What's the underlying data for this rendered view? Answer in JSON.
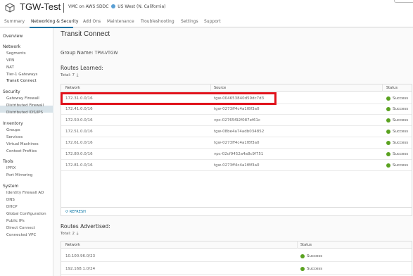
{
  "header": {
    "sddc_name": "TGW-Test",
    "subtitle": "VMC on AWS SDDC",
    "region": "US West (N. California)"
  },
  "tabs": [
    {
      "label": "Summary"
    },
    {
      "label": "Networking & Security",
      "active": true
    },
    {
      "label": "Add Ons"
    },
    {
      "label": "Maintenance"
    },
    {
      "label": "Troubleshooting"
    },
    {
      "label": "Settings"
    },
    {
      "label": "Support"
    }
  ],
  "sidebar": {
    "overview": "Overview",
    "sections": [
      {
        "title": "Network",
        "items": [
          "Segments",
          "VPN",
          "NAT",
          "Tier-1 Gateways",
          "Transit Connect"
        ]
      },
      {
        "title": "Security",
        "items": [
          "Gateway Firewall",
          "Distributed Firewall",
          "Distributed IDS/IPS"
        ]
      },
      {
        "title": "Inventory",
        "items": [
          "Groups",
          "Services",
          "Virtual Machines",
          "Context Profiles"
        ]
      },
      {
        "title": "Tools",
        "items": [
          "IPFIX",
          "Port Mirroring"
        ]
      },
      {
        "title": "System",
        "items": [
          "Identity Firewall AD",
          "DNS",
          "DHCP",
          "Global Configuration",
          "Public IPs",
          "Direct Connect",
          "Connected VPC"
        ]
      }
    ],
    "active_item": "Transit Connect"
  },
  "main": {
    "title": "Transit Connect",
    "group_name_label": "Group Name:",
    "group_name_value": "TPM-VTGW",
    "routes_learned": {
      "title": "Routes Learned:",
      "total": "Total: 7",
      "columns": [
        "Network",
        "Source",
        "Status"
      ],
      "rows": [
        {
          "network": "172.31.0.0/16",
          "source": "tgw-004653840d59dc7d3",
          "status": "Success"
        },
        {
          "network": "172.41.0.0/16",
          "source": "tgw-0273ff4c4a1f8f3a0",
          "status": "Success"
        },
        {
          "network": "172.50.0.0/16",
          "source": "vpc-02765f92f087ef61c",
          "status": "Success"
        },
        {
          "network": "172.51.0.0/16",
          "source": "tgw-08be4a74adb034852",
          "status": "Success"
        },
        {
          "network": "172.61.0.0/16",
          "source": "tgw-0273ff4c4a1f8f3a0",
          "status": "Success"
        },
        {
          "network": "172.80.0.0/16",
          "source": "vpc-02cf9452a4a8c9f751",
          "status": "Success"
        },
        {
          "network": "172.81.0.0/16",
          "source": "tgw-0273ff4c4a1f8f3a0",
          "status": "Success"
        }
      ],
      "refresh_label": "REFRESH"
    },
    "routes_advertised": {
      "title": "Routes Advertised:",
      "total": "Total: 2",
      "columns": [
        "Network",
        "Status"
      ],
      "rows": [
        {
          "network": "10.100.96.0/23",
          "status": "Success"
        },
        {
          "network": "192.168.1.0/24",
          "status": "Success"
        }
      ]
    }
  },
  "colors": {
    "accent": "#0072a3",
    "success": "#5aa220",
    "highlight": "#e0121b"
  }
}
